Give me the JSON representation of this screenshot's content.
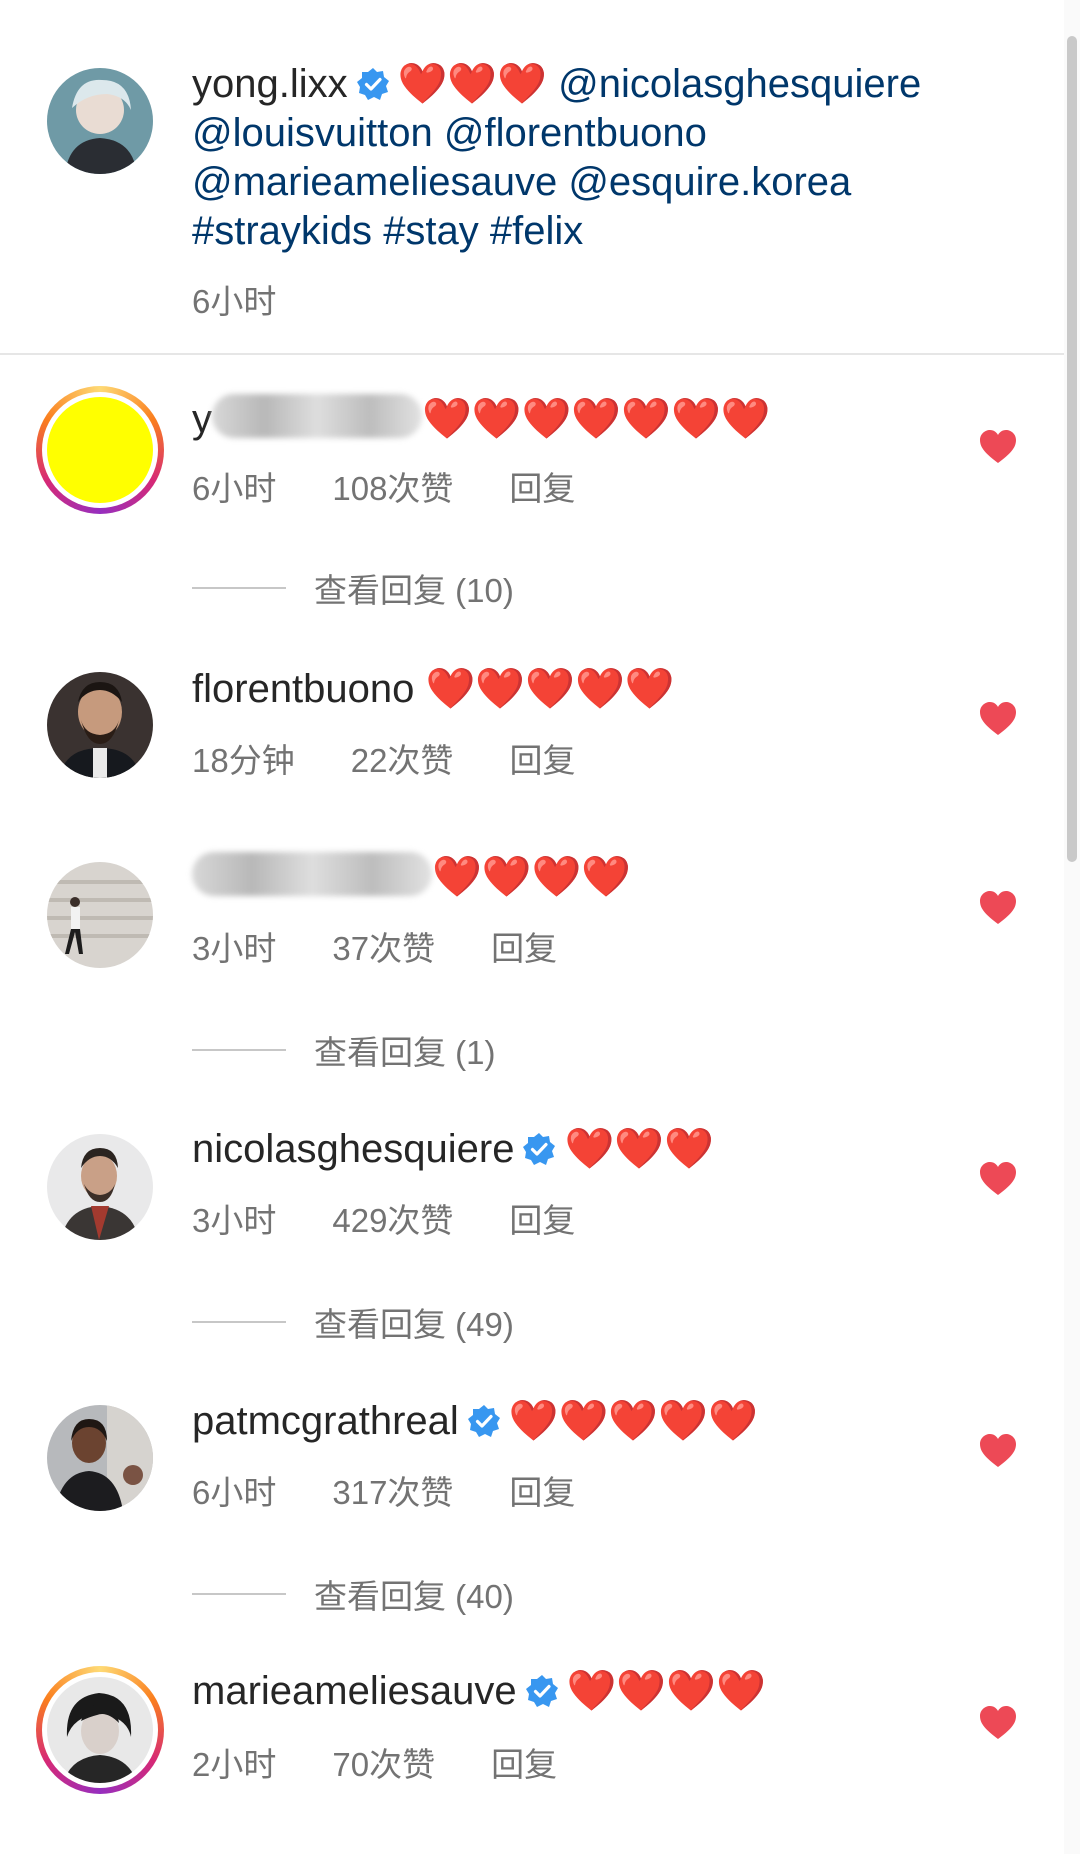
{
  "caption": {
    "username": "yong.lixx",
    "hearts": "❤️❤️❤️",
    "mentions": [
      "@nicolasghesquiere",
      "@louisvuitton",
      "@florentbuono",
      "@marieameliesauve",
      "@esquire.korea"
    ],
    "hashtags": [
      "#straykids",
      "#stay",
      "#felix"
    ],
    "time": "6小时"
  },
  "comments": [
    {
      "username": "y",
      "hearts": "❤️❤️❤️❤️❤️❤️❤️",
      "time": "6小时",
      "likes": "108次赞",
      "reply": "回复",
      "view_replies": "查看回复 (10)",
      "verified": false,
      "avatar_color": "#ffff00"
    },
    {
      "username": "florentbuono",
      "hearts": "❤️❤️❤️❤️❤️",
      "time": "18分钟",
      "likes": "22次赞",
      "reply": "回复",
      "verified": false
    },
    {
      "username": "",
      "hearts": "❤️❤️❤️❤️",
      "time": "3小时",
      "likes": "37次赞",
      "reply": "回复",
      "view_replies": "查看回复 (1)",
      "verified": false
    },
    {
      "username": "nicolasghesquiere",
      "hearts": "❤️❤️❤️",
      "time": "3小时",
      "likes": "429次赞",
      "reply": "回复",
      "view_replies": "查看回复 (49)",
      "verified": true
    },
    {
      "username": "patmcgrathreal",
      "hearts": "❤️❤️❤️❤️❤️",
      "time": "6小时",
      "likes": "317次赞",
      "reply": "回复",
      "view_replies": "查看回复 (40)",
      "verified": true
    },
    {
      "username": "marieameliesauve",
      "hearts": "❤️❤️❤️❤️",
      "time": "2小时",
      "likes": "70次赞",
      "reply": "回复",
      "verified": true
    }
  ],
  "colors": {
    "heart": "#ed4956",
    "verified": "#3897f0",
    "link": "#00376b",
    "meta": "#737373"
  }
}
